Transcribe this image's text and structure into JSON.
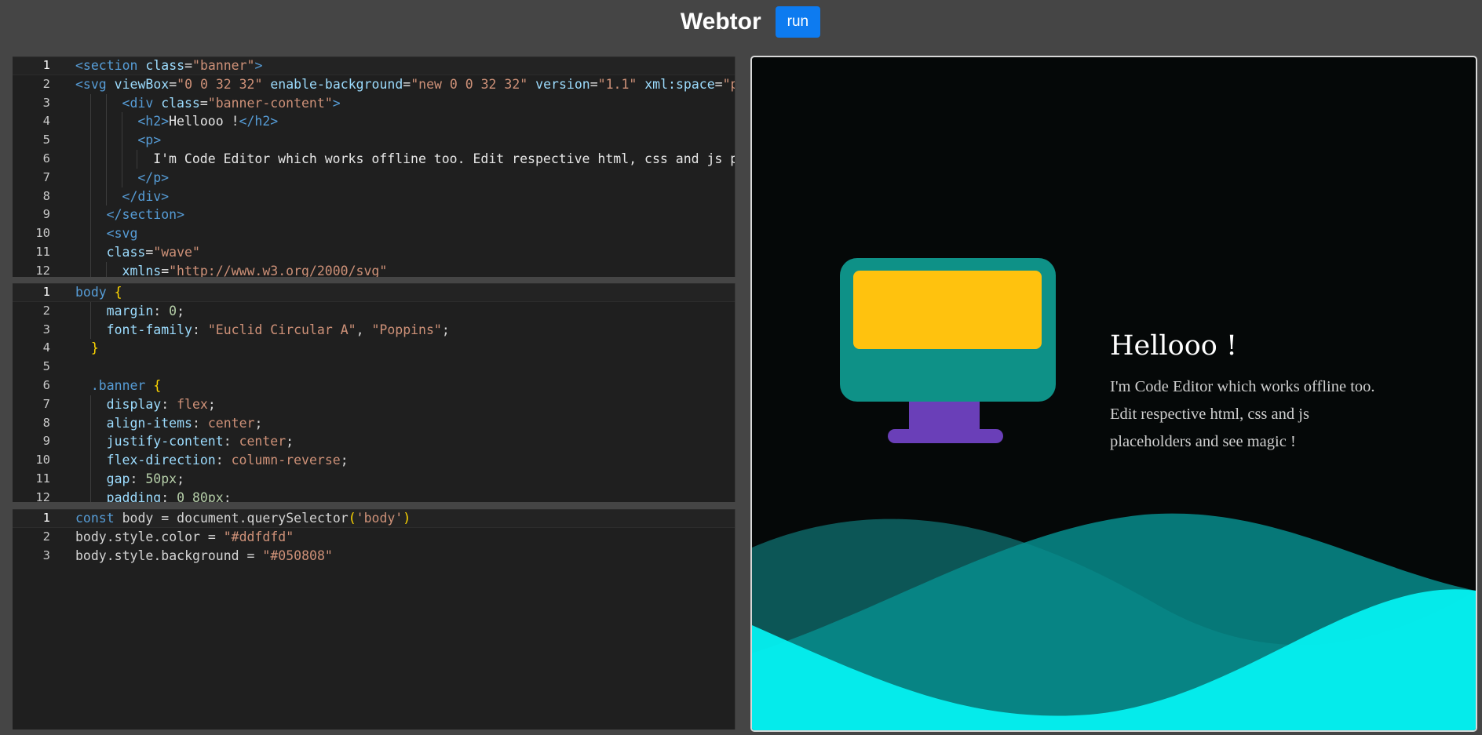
{
  "header": {
    "title": "Webtor",
    "run_label": "run"
  },
  "editors": {
    "html": {
      "lines": [
        {
          "n": "1",
          "indent": 0,
          "tokens": [
            [
              "t-tag",
              "<section "
            ],
            [
              "t-attr",
              "class"
            ],
            [
              "t-txt",
              "="
            ],
            [
              "t-str",
              "\"banner\""
            ],
            [
              "t-tag",
              ">"
            ]
          ]
        },
        {
          "n": "2",
          "indent": 0,
          "tokens": [
            [
              "t-tag",
              "<svg "
            ],
            [
              "t-attr",
              "viewBox"
            ],
            [
              "t-txt",
              "="
            ],
            [
              "t-str",
              "\"0 0 32 32\" "
            ],
            [
              "t-attr",
              "enable-background"
            ],
            [
              "t-txt",
              "="
            ],
            [
              "t-str",
              "\"new 0 0 32 32\" "
            ],
            [
              "t-attr",
              "version"
            ],
            [
              "t-txt",
              "="
            ],
            [
              "t-str",
              "\"1.1\" "
            ],
            [
              "t-attr",
              "xml:space"
            ],
            [
              "t-txt",
              "="
            ],
            [
              "t-str",
              "\"preserve\""
            ]
          ]
        },
        {
          "n": "3",
          "indent": 3,
          "tokens": [
            [
              "t-tag",
              "<div "
            ],
            [
              "t-attr",
              "class"
            ],
            [
              "t-txt",
              "="
            ],
            [
              "t-str",
              "\"banner-content\""
            ],
            [
              "t-tag",
              ">"
            ]
          ]
        },
        {
          "n": "4",
          "indent": 4,
          "tokens": [
            [
              "t-tag",
              "<h2>"
            ],
            [
              "t-txt",
              "Hellooo !"
            ],
            [
              "t-tag",
              "</h2>"
            ]
          ]
        },
        {
          "n": "5",
          "indent": 4,
          "tokens": [
            [
              "t-tag",
              "<p>"
            ]
          ]
        },
        {
          "n": "6",
          "indent": 5,
          "tokens": [
            [
              "t-txt",
              "I'm Code Editor which works offline too. Edit respective html, css and js placeholders and see magic !"
            ]
          ]
        },
        {
          "n": "7",
          "indent": 4,
          "tokens": [
            [
              "t-tag",
              "</p>"
            ]
          ]
        },
        {
          "n": "8",
          "indent": 3,
          "tokens": [
            [
              "t-tag",
              "</div>"
            ]
          ]
        },
        {
          "n": "9",
          "indent": 2,
          "tokens": [
            [
              "t-tag",
              "</section>"
            ]
          ]
        },
        {
          "n": "10",
          "indent": 2,
          "tokens": [
            [
              "t-tag",
              "<svg"
            ]
          ]
        },
        {
          "n": "11",
          "indent": 2,
          "tokens": [
            [
              "t-attr",
              "class"
            ],
            [
              "t-txt",
              "="
            ],
            [
              "t-str",
              "\"wave\""
            ]
          ]
        },
        {
          "n": "12",
          "indent": 3,
          "tokens": [
            [
              "t-attr",
              "xmlns"
            ],
            [
              "t-txt",
              "="
            ],
            [
              "t-str",
              "\"http://www.w3.org/2000/svg\""
            ]
          ]
        }
      ]
    },
    "css": {
      "lines": [
        {
          "n": "1",
          "indent": 0,
          "tokens": [
            [
              "t-sel",
              "body "
            ],
            [
              "t-brace",
              "{"
            ]
          ]
        },
        {
          "n": "2",
          "indent": 2,
          "tokens": [
            [
              "t-prop",
              "margin"
            ],
            [
              "t-var",
              ": "
            ],
            [
              "t-num",
              "0"
            ],
            [
              "t-var",
              ";"
            ]
          ]
        },
        {
          "n": "3",
          "indent": 2,
          "tokens": [
            [
              "t-prop",
              "font-family"
            ],
            [
              "t-var",
              ": "
            ],
            [
              "t-val",
              "\"Euclid Circular A\""
            ],
            [
              "t-var",
              ", "
            ],
            [
              "t-val",
              "\"Poppins\""
            ],
            [
              "t-var",
              ";"
            ]
          ]
        },
        {
          "n": "4",
          "indent": 1,
          "tokens": [
            [
              "t-brace",
              "}"
            ]
          ]
        },
        {
          "n": "5",
          "indent": 0,
          "tokens": []
        },
        {
          "n": "6",
          "indent": 1,
          "tokens": [
            [
              "t-sel",
              ".banner "
            ],
            [
              "t-brace",
              "{"
            ]
          ]
        },
        {
          "n": "7",
          "indent": 2,
          "tokens": [
            [
              "t-prop",
              "display"
            ],
            [
              "t-var",
              ": "
            ],
            [
              "t-val",
              "flex"
            ],
            [
              "t-var",
              ";"
            ]
          ]
        },
        {
          "n": "8",
          "indent": 2,
          "tokens": [
            [
              "t-prop",
              "align-items"
            ],
            [
              "t-var",
              ": "
            ],
            [
              "t-val",
              "center"
            ],
            [
              "t-var",
              ";"
            ]
          ]
        },
        {
          "n": "9",
          "indent": 2,
          "tokens": [
            [
              "t-prop",
              "justify-content"
            ],
            [
              "t-var",
              ": "
            ],
            [
              "t-val",
              "center"
            ],
            [
              "t-var",
              ";"
            ]
          ]
        },
        {
          "n": "10",
          "indent": 2,
          "tokens": [
            [
              "t-prop",
              "flex-direction"
            ],
            [
              "t-var",
              ": "
            ],
            [
              "t-val",
              "column-reverse"
            ],
            [
              "t-var",
              ";"
            ]
          ]
        },
        {
          "n": "11",
          "indent": 2,
          "tokens": [
            [
              "t-prop",
              "gap"
            ],
            [
              "t-var",
              ": "
            ],
            [
              "t-num",
              "50px"
            ],
            [
              "t-var",
              ";"
            ]
          ]
        },
        {
          "n": "12",
          "indent": 2,
          "tokens": [
            [
              "t-prop",
              "padding"
            ],
            [
              "t-var",
              ": "
            ],
            [
              "t-num",
              "0 80px"
            ],
            [
              "t-var",
              ";"
            ]
          ]
        }
      ]
    },
    "js": {
      "lines": [
        {
          "n": "1",
          "indent": 0,
          "tokens": [
            [
              "t-kw",
              "const "
            ],
            [
              "t-var",
              "body = document.querySelector"
            ],
            [
              "t-paren",
              "("
            ],
            [
              "t-str",
              "'body'"
            ],
            [
              "t-paren",
              ")"
            ]
          ]
        },
        {
          "n": "2",
          "indent": 0,
          "tokens": [
            [
              "t-var",
              "body.style.color = "
            ],
            [
              "t-str",
              "\"#ddfdfd\""
            ]
          ]
        },
        {
          "n": "3",
          "indent": 0,
          "tokens": [
            [
              "t-var",
              "body.style.background = "
            ],
            [
              "t-str",
              "\"#050808\""
            ]
          ]
        }
      ]
    }
  },
  "preview": {
    "title": "Hellooo !",
    "text_lines": [
      "I'm Code Editor which works offline too.",
      "Edit respective html, css and js",
      "placeholders and see magic !"
    ],
    "colors": {
      "background": "#050808",
      "monitor_body": "#0e9187",
      "monitor_screen": "#ffc20e",
      "monitor_stand": "#6a3fb8",
      "wave_dark": "#0d5f5f",
      "wave_mid": "#078c8c",
      "wave_bright": "#05f0f0"
    }
  }
}
